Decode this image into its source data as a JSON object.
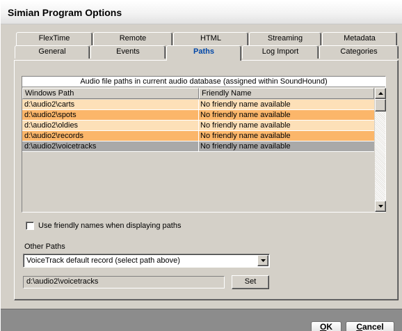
{
  "window": {
    "title": "Simian Program Options"
  },
  "tabs": {
    "row_back": [
      {
        "label": "FlexTime"
      },
      {
        "label": "Remote"
      },
      {
        "label": "HTML"
      },
      {
        "label": "Streaming"
      },
      {
        "label": "Metadata"
      }
    ],
    "row_front": [
      {
        "label": "General"
      },
      {
        "label": "Events"
      },
      {
        "label": "Paths",
        "active": true
      },
      {
        "label": "Log Import"
      },
      {
        "label": "Categories"
      }
    ]
  },
  "audio_paths": {
    "caption": "Audio file paths in current audio database (assigned within SoundHound)",
    "columns": [
      "Windows Path",
      "Friendly Name"
    ],
    "rows": [
      {
        "path": "d:\\audio2\\carts",
        "friendly": "No friendly name available",
        "color": "#fde0b8"
      },
      {
        "path": "d:\\audio2\\spots",
        "friendly": "No friendly name available",
        "color": "#fbb66a"
      },
      {
        "path": "d:\\audio2\\oldies",
        "friendly": "No friendly name available",
        "color": "#fde0b8"
      },
      {
        "path": "d:\\audio2\\records",
        "friendly": "No friendly name available",
        "color": "#fbb66a"
      },
      {
        "path": "d:\\audio2\\voicetracks",
        "friendly": "No friendly name available",
        "color": "#a9a9a9"
      }
    ]
  },
  "friendly_checkbox": {
    "label": "Use friendly names when displaying paths",
    "checked": false
  },
  "other_paths": {
    "label": "Other Paths",
    "selected": "VoiceTrack default record (select path above)",
    "path_value": "d:\\audio2\\voicetracks",
    "set_label": "Set"
  },
  "buttons": {
    "ok_underlined": "O",
    "ok_rest": "K",
    "cancel_underlined": "C",
    "cancel_rest": "ancel"
  },
  "colors": {
    "active_tab_text": "#0047a8",
    "row_light": "#fde0b8",
    "row_dark": "#fbb66a",
    "row_selected": "#a9a9a9"
  }
}
